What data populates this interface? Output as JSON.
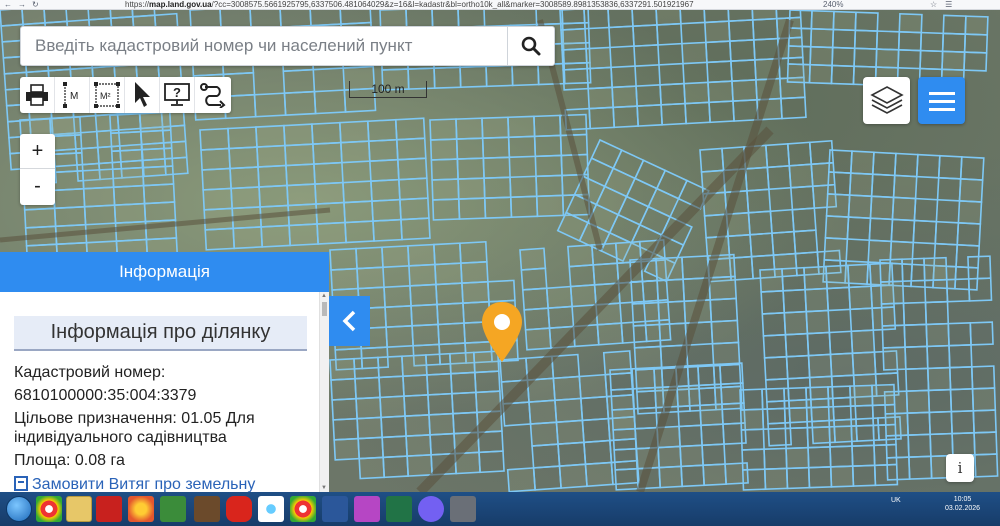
{
  "browser": {
    "url_host": "map.land.gov.ua",
    "url_rest": "/?cc=3008575.5661925795,6337506.481064029&z=16&l=kadastr&bl=ortho10k_all&marker=3008589.8981353836,6337291.501921967",
    "url_prefix": "https://",
    "zoom": "240%"
  },
  "search": {
    "placeholder": "Введіть кадастровий номер чи населений пункт",
    "value": ""
  },
  "toolbar": {
    "tools": [
      "print-icon",
      "measure-length-icon",
      "measure-area-icon",
      "pointer-icon",
      "help-icon",
      "route-icon"
    ],
    "length_label": "M",
    "area_label": "M²"
  },
  "map": {
    "scale_label": "100 m",
    "parcel_color": "#7ec8f5"
  },
  "zoom": {
    "plus": "+",
    "minus": "-"
  },
  "info_panel": {
    "header": "Інформація",
    "title": "Інформація про ділянку",
    "cadastral_label": "Кадастровий номер:",
    "cadastral_number": "6810100000:35:004:3379",
    "purpose": "Цільове призначення: 01.05 Для індивідуального садівництва",
    "area": "Площа: 0.08 га",
    "order_link": "Замовити Витяг про земельну"
  },
  "corner_info": "i",
  "taskbar": {
    "lang": "UK",
    "time": "10:05",
    "date": "03.02.2026"
  },
  "colors": {
    "accent": "#2f8cf0",
    "marker": "#f5a623"
  }
}
